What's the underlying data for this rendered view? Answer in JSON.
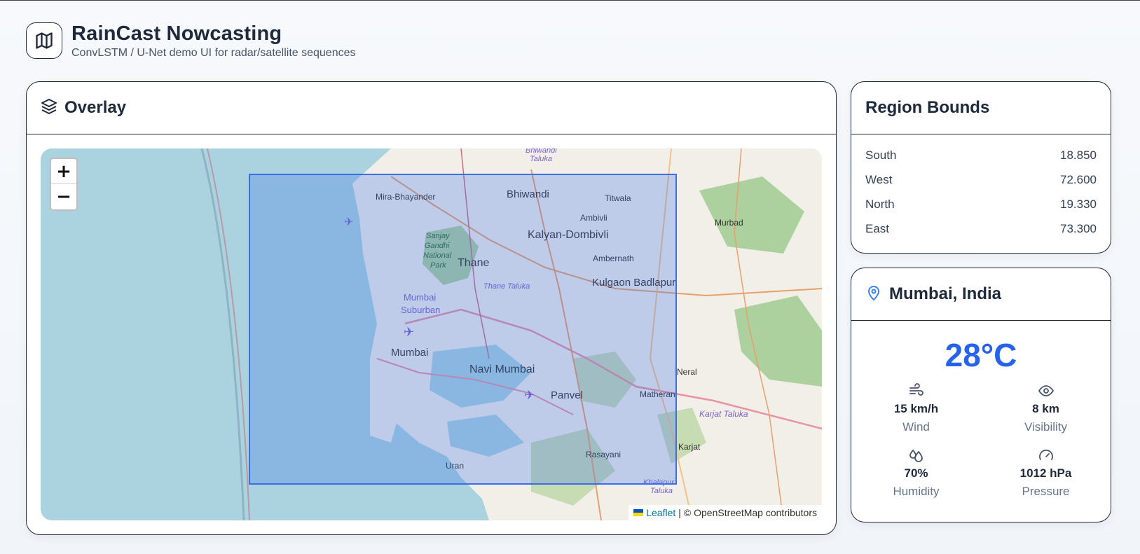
{
  "header": {
    "title": "RainCast Nowcasting",
    "subtitle": "ConvLSTM / U-Net demo UI for radar/satellite sequences",
    "icon": "map-icon"
  },
  "overlay": {
    "title": "Overlay",
    "icon": "layers-icon",
    "zoom_in": "+",
    "zoom_out": "−",
    "attribution_link": "Leaflet",
    "attribution_sep": "|",
    "attribution_text": "© OpenStreetMap contributors",
    "places": {
      "bhiwandi": "Bhiwandi",
      "mira": "Mira-Bhayander",
      "titwala": "Titwala",
      "ambivli": "Ambivli",
      "murbad": "Murbad",
      "kalyan": "Kalyan-Dombivli",
      "sanjay1": "Sanjay",
      "sanjay2": "Gandhi",
      "sanjay3": "National",
      "sanjay4": "Park",
      "thane": "Thane",
      "ambernath": "Ambernath",
      "thane_taluka": "Thane Taluka",
      "kulgaon": "Kulgaon Badlapur",
      "mumbai_sub1": "Mumbai",
      "mumbai_sub2": "Suburban",
      "mumbai": "Mumbai",
      "navi_mumbai": "Navi Mumbai",
      "neral": "Neral",
      "panvel": "Panvel",
      "matheran": "Matheran",
      "karjat_taluka": "Karjat Taluka",
      "karjat": "Karjat",
      "rasayani": "Rasayani",
      "uran": "Uran",
      "khalapur": "Khalapur",
      "taluka": "Taluka",
      "bhiwandi_taluka1": "Bhiwandi",
      "bhiwandi_taluka2": "Taluka"
    }
  },
  "bounds": {
    "title": "Region Bounds",
    "rows": [
      {
        "label": "South",
        "value": "18.850"
      },
      {
        "label": "West",
        "value": "72.600"
      },
      {
        "label": "North",
        "value": "19.330"
      },
      {
        "label": "East",
        "value": "73.300"
      }
    ]
  },
  "weather": {
    "location": "Mumbai, India",
    "icon": "map-pin-icon",
    "temperature": "28°C",
    "metrics": [
      {
        "icon": "wind-icon",
        "value": "15 km/h",
        "label": "Wind"
      },
      {
        "icon": "eye-icon",
        "value": "8 km",
        "label": "Visibility"
      },
      {
        "icon": "droplets-icon",
        "value": "70%",
        "label": "Humidity"
      },
      {
        "icon": "gauge-icon",
        "value": "1012 hPa",
        "label": "Pressure"
      }
    ]
  },
  "colors": {
    "accent": "#2563eb",
    "sea": "#aad3df",
    "overlay_fill": "#3b6ee8",
    "border": "#1e293b"
  }
}
